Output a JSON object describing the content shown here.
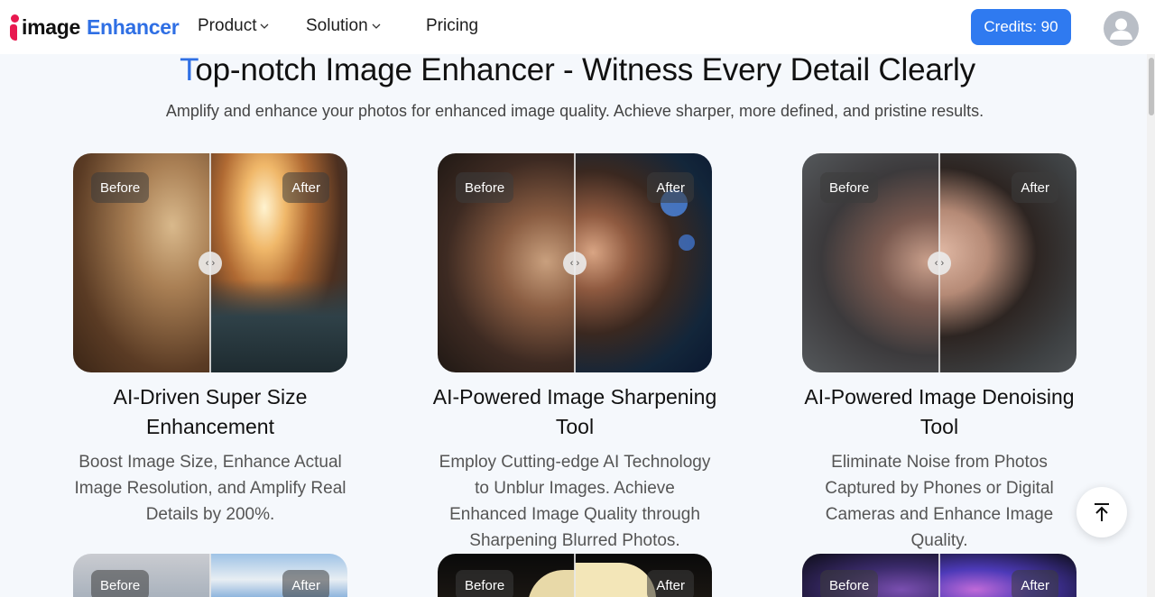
{
  "header": {
    "logo_image": "image",
    "logo_enhancer": "Enhancer",
    "nav": [
      {
        "label": "Product",
        "has_dropdown": true
      },
      {
        "label": "Solution",
        "has_dropdown": true
      },
      {
        "label": "Pricing",
        "has_dropdown": false
      }
    ],
    "credits_label": "Credits: 90",
    "avatar_icon": "user-avatar-icon"
  },
  "hero": {
    "title_first_letter": "T",
    "title_rest": "op-notch Image Enhancer - Witness Every Detail Clearly",
    "subtitle": "Amplify and enhance your photos for enhanced image quality. Achieve sharper, more defined, and pristine results."
  },
  "compare_labels": {
    "before": "Before",
    "after": "After"
  },
  "cards": [
    {
      "title": "AI-Driven Super Size Enhancement",
      "description": "Boost Image Size, Enhance Actual Image Resolution, and Amplify Real Details by 200%."
    },
    {
      "title": "AI-Powered Image Sharpening Tool",
      "description": "Employ Cutting-edge AI Technology to Unblur Images. Achieve Enhanced Image Quality through Sharpening Blurred Photos."
    },
    {
      "title": "AI-Powered Image Denoising Tool",
      "description": "Eliminate Noise from Photos Captured by Phones or Digital Cameras and Enhance Image Quality."
    }
  ],
  "colors": {
    "brand_blue": "#2f6fe4",
    "logo_pink": "#e8194f",
    "credits_button": "#2f7af0",
    "page_bg": "#f5f8fc"
  },
  "icons": {
    "back_to_top": "arrow-up-to-line-icon",
    "compare_handle": "chevron-left-right-icon"
  }
}
